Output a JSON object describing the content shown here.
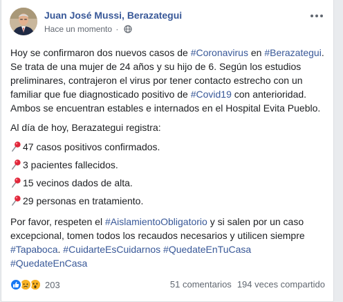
{
  "post": {
    "author": "Juan José Mussi, Berazategui",
    "timestamp": "Hace un momento",
    "separator": "·",
    "privacy_icon": "globe-icon",
    "more_icon": "more-options-icon",
    "paragraph1": {
      "t1": "Hoy se confirmaron dos nuevos casos de ",
      "tag1": "#Coronavirus",
      "t2": " en ",
      "tag2": "#Berazategui",
      "t3": ". Se trata de una mujer de 24 años y su hijo de 6. Según los estudios preliminares, contrajeron el virus por tener contacto estrecho con un familiar que fue diagnosticado positivo de ",
      "tag3": "#Covid19",
      "t4": " con anterioridad. Ambos se encuentran estables e internados en el Hospital Evita Pueblo."
    },
    "intro": "Al día de hoy, Berazategui registra:",
    "stats": [
      "47 casos positivos confirmados.",
      "3 pacientes fallecidos.",
      "15 vecinos dados de alta.",
      "29 personas en tratamiento."
    ],
    "stat_icon": "round-pushpin-icon",
    "paragraph2": {
      "t1": "Por favor, respeten el ",
      "tag1": "#AislamientoObligatorio",
      "t2": " y si salen por un caso excepcional, tomen todos los recaudos necesarios y utilicen siempre ",
      "tag2": "#Tapaboca",
      "t3": ". ",
      "tag3": "#CuidarteEsCuidarnos",
      "t4": " ",
      "tag4": "#QuedateEnTuCasa",
      "t5": " ",
      "tag5": "#QuedateEnCasa"
    }
  },
  "footer": {
    "reaction_icons": [
      "like-icon",
      "sad-icon",
      "wow-icon"
    ],
    "reaction_count": "203",
    "comments": "51 comentarios",
    "shares": "194 veces compartido"
  },
  "colors": {
    "link": "#385898",
    "text": "#1c1e21",
    "meta": "#616770",
    "like": "#1877f2",
    "emoji": "#f7b125",
    "pin": "#e0283b"
  }
}
